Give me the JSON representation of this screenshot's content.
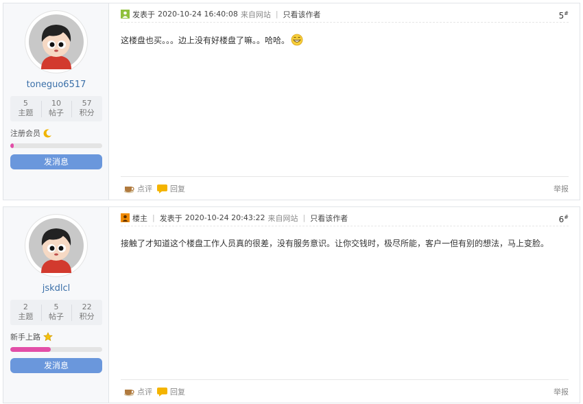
{
  "posts": [
    {
      "user": {
        "name": "toneguo6517",
        "stats": [
          {
            "value": "5",
            "label": "主题"
          },
          {
            "value": "10",
            "label": "帖子"
          },
          {
            "value": "57",
            "label": "积分"
          }
        ],
        "group": "注册会员",
        "group_icon": "moon-icon",
        "progress": 0.04,
        "message_button": "发消息"
      },
      "meta": {
        "is_op": false,
        "op_label": "",
        "posted_prefix": "发表于",
        "datetime": "2020-10-24 16:40:08",
        "source": "来自网站",
        "only_author": "只看该作者",
        "floor": "5",
        "floor_mark": "#"
      },
      "content": "这楼盘也买。。。边上没有好楼盘了嘛。。哈哈。",
      "footer": {
        "comment": "点评",
        "reply": "回复",
        "report": "举报"
      }
    },
    {
      "user": {
        "name": "jskdlcl",
        "stats": [
          {
            "value": "2",
            "label": "主题"
          },
          {
            "value": "5",
            "label": "帖子"
          },
          {
            "value": "22",
            "label": "积分"
          }
        ],
        "group": "新手上路",
        "group_icon": "star-icon",
        "progress": 0.44,
        "message_button": "发消息"
      },
      "meta": {
        "is_op": true,
        "op_label": "楼主",
        "posted_prefix": "发表于",
        "datetime": "2020-10-24 20:43:22",
        "source": "来自网站",
        "only_author": "只看该作者",
        "floor": "6",
        "floor_mark": "#"
      },
      "content": "接触了才知道这个楼盘工作人员真的很差，没有服务意识。让你交钱时，极尽所能，客户一但有别的想法，马上变脸。",
      "footer": {
        "comment": "点评",
        "reply": "回复",
        "report": "举报"
      }
    }
  ],
  "colors": {
    "link": "#3a6fa8",
    "button": "#6a97dc",
    "progress": "#e24ea8"
  }
}
